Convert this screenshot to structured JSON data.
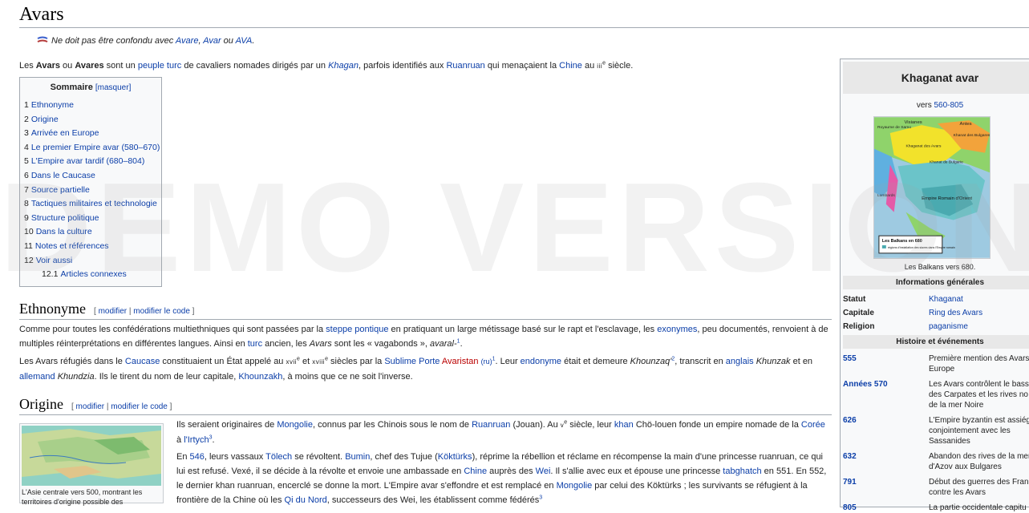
{
  "page": {
    "title": "Avars"
  },
  "hatnote": {
    "prefix": "Ne doit pas être confondu avec ",
    "l1": "Avare",
    "sep1": ", ",
    "l2": "Avar",
    "sep2": " ou ",
    "l3": "AVA",
    "end": "."
  },
  "intro": {
    "t1": "Les ",
    "b1": "Avars",
    "t2": " ou ",
    "b2": "Avares",
    "t3": " sont un ",
    "l1": "peuple turc",
    "t4": " de cavaliers nomades dirigés par un ",
    "l2": "Khagan",
    "t5": ", parfois identifiés aux ",
    "l3": "Ruanruan",
    "t6": " qui menaçaient la ",
    "l4": "Chine",
    "t7": " au ",
    "roman": "iii",
    "sup": "e",
    "t8": " siècle."
  },
  "toc": {
    "title": "Sommaire",
    "toggle": "[masquer]",
    "items": [
      {
        "num": "1",
        "label": "Ethnonyme"
      },
      {
        "num": "2",
        "label": "Origine"
      },
      {
        "num": "3",
        "label": "Arrivée en Europe"
      },
      {
        "num": "4",
        "label": "Le premier Empire avar (580–670)"
      },
      {
        "num": "5",
        "label": "L'Empire avar tardif (680–804)"
      },
      {
        "num": "6",
        "label": "Dans le Caucase"
      },
      {
        "num": "7",
        "label": "Source partielle"
      },
      {
        "num": "8",
        "label": "Tactiques militaires et technologie"
      },
      {
        "num": "9",
        "label": "Structure politique"
      },
      {
        "num": "10",
        "label": "Dans la culture"
      },
      {
        "num": "11",
        "label": "Notes et références"
      },
      {
        "num": "12",
        "label": "Voir aussi"
      },
      {
        "num": "12.1",
        "label": "Articles connexes"
      }
    ]
  },
  "edit": {
    "open": "[ ",
    "modifier": "modifier",
    "sep": " | ",
    "code": "modifier le code",
    "close": " ]"
  },
  "ethnonyme": {
    "heading": "Ethnonyme",
    "p1": {
      "t1": "Comme pour toutes les confédérations multiethniques qui sont passées par la ",
      "l1": "steppe pontique",
      "t2": " en pratiquant un large métissage basé sur le rapt et l'esclavage, les ",
      "l2": "exonymes",
      "t3": ", peu documentés, renvoient à de multiples réinterprétations en différentes langues. Ainsi en ",
      "l3": "turc",
      "t4": " ancien, les ",
      "i1": "Avars",
      "t5": " sont les « vagabonds », ",
      "i2": "avaral-",
      "sup1": "1",
      "t6": "."
    },
    "p2": {
      "t1": "Les Avars réfugiés dans le ",
      "l1": "Caucase",
      "t2": " constituaient un État appelé au ",
      "r1": "xvii",
      "s1": "e",
      "t3": " et ",
      "r2": "xviii",
      "s2": "e",
      "t4": " siècles par la ",
      "l2": "Sublime Porte",
      "red1": "Avaristan",
      "ru": "(ru)",
      "sup1": "1",
      "t5": ". Leur ",
      "l3": "endonyme",
      "t6": " était et demeure ",
      "i1": "Khounzaq'",
      "sup2": "2",
      "t7": ", transcrit en ",
      "l4": "anglais",
      "i2": "Khunzak",
      "t8": " et en ",
      "l5": "allemand",
      "i3": "Khundzia",
      "t9": ". Ils le tirent du nom de leur capitale, ",
      "l6": "Khounzakh",
      "t10": ", à moins que ce ne soit l'inverse."
    }
  },
  "origine": {
    "heading": "Origine",
    "thumb_caption": "L'Asie centrale vers 500, montrant les territoires d'origine possible des",
    "p1": {
      "t1": "Ils seraient originaires de ",
      "l1": "Mongolie",
      "t2": ", connus par les Chinois sous le nom de ",
      "l2": "Ruanruan",
      "t3": " (Jouan). Au ",
      "r1": "v",
      "s1": "e",
      "t4": " siècle, leur ",
      "l3": "khan",
      "t5": " Chö-louen fonde un empire nomade de la ",
      "l4": "Corée",
      "t6": " à ",
      "l5": "l'Irtych",
      "sup1": "3",
      "t7": "."
    },
    "p2": {
      "t1": "En ",
      "l1": "546",
      "t2": ", leurs vassaux ",
      "l2": "Tölech",
      "t3": " se révoltent. ",
      "l3": "Bumin",
      "t4": ", chef des Tujue (",
      "l4": "Köktürks",
      "t5": "), réprime la rébellion et réclame en récompense la main d'une princesse ruanruan, ce qui lui est refusé. Vexé, il se décide à la révolte et envoie une ambassade en ",
      "l5": "Chine",
      "t6": " auprès des ",
      "l6": "Wei",
      "t7": ". Il s'allie avec eux et épouse une princesse ",
      "l7": "tabghatch",
      "t8": " en 551. En 552, le dernier khan ruanruan, encerclé se donne la mort. L'Empire avar s'effondre et est remplacé en ",
      "l8": "Mongolie",
      "t9": " par celui des Köktürks ; les survivants se réfugient à la frontière de la Chine où les ",
      "l9": "Qi du Nord",
      "t10": ", successeurs des Wei, les établissent comme fédérés",
      "sup1": "3"
    }
  },
  "watermark": "DEMO VERSION",
  "infobox": {
    "title": "Khaganat avar",
    "period_prefix": "vers ",
    "period": "560-805",
    "map_caption": "Les Balkans vers 680.",
    "map_labels": {
      "visianes": "Visianes",
      "antes": "Antes",
      "samo": "Royaume de Samo",
      "bulgares": "Khanat des Bulgares",
      "avars": "Khaganat des Avars",
      "kh_bulg": "Khanat de Bulgarie",
      "lombards": "Lombards",
      "empire": "Empire Romain d'Orient",
      "legend_title": "Les Balkans en 680",
      "legend_text": "régions d'installation des slaves dans l'Empire romain"
    },
    "general_head": "Informations générales",
    "general": [
      {
        "key": "Statut",
        "value": "Khaganat"
      },
      {
        "key": "Capitale",
        "value": "Ring des Avars"
      },
      {
        "key": "Religion",
        "value": "paganisme"
      }
    ],
    "events_head": "Histoire et événements",
    "events": [
      {
        "year": "555",
        "t1": "Première mention des Avars",
        "t2": "Europe"
      },
      {
        "year": "Années 570",
        "t1": "Les Avars contrôlent le bass",
        "t2": "des Carpates et les rives no",
        "t3": "de la mer Noire"
      },
      {
        "year": "626",
        "t1": "L'Empire byzantin est assiég",
        "t2": "conjointement avec les",
        "t3": "Sassanides"
      },
      {
        "year": "632",
        "t1": "Abandon des rives de la mer",
        "t2": "d'Azov aux Bulgares"
      },
      {
        "year": "791",
        "t1": "Début des guerres des Fran",
        "t2": "contre les Avars"
      },
      {
        "year": "805",
        "t1": "La partie occidentale capitu"
      }
    ]
  },
  "colors": {
    "link": "#0b3ea8",
    "redlink": "#ba0000",
    "border": "#a2a9b1",
    "infobox_bg": "#f8f9fa"
  }
}
